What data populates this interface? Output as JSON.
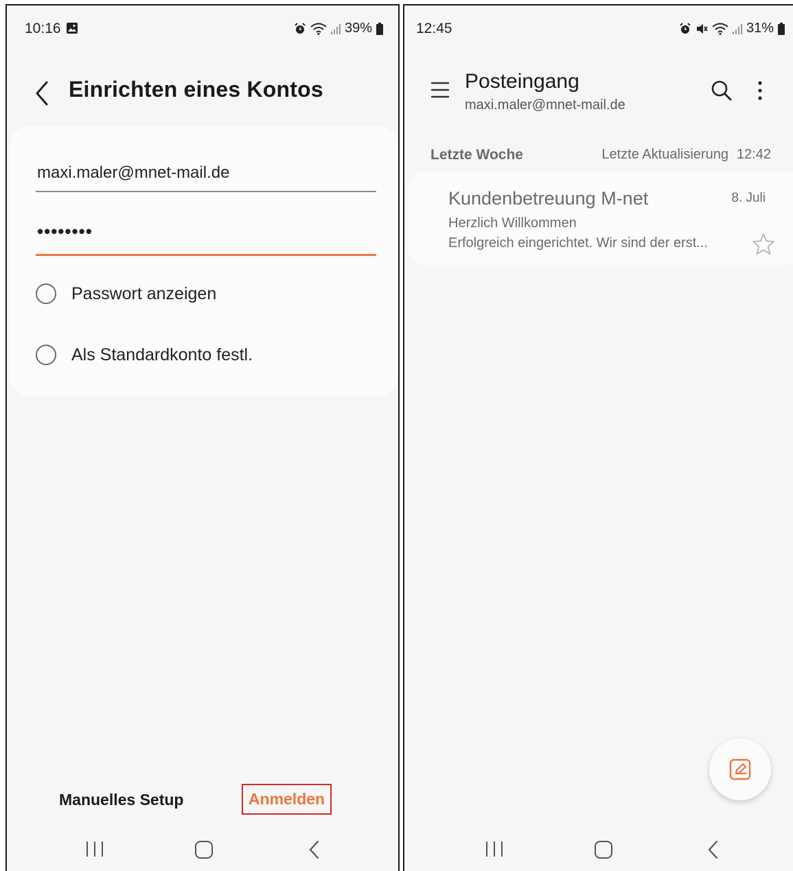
{
  "left_screen": {
    "status": {
      "time": "10:16",
      "battery": "39%"
    },
    "header": {
      "title": "Einrichten eines Kontos"
    },
    "form": {
      "email_value": "maxi.maler@mnet-mail.de",
      "password_value": "••••••••",
      "show_password_label": "Passwort anzeigen",
      "default_account_label": "Als Standardkonto festl."
    },
    "footer": {
      "manual_setup_label": "Manuelles Setup",
      "login_label": "Anmelden"
    },
    "colors": {
      "accent": "#ee7640",
      "highlight_box": "#d42a2a"
    }
  },
  "right_screen": {
    "status": {
      "time": "12:45",
      "battery": "31%"
    },
    "header": {
      "title": "Posteingang",
      "account": "maxi.maler@mnet-mail.de"
    },
    "section": {
      "label": "Letzte Woche",
      "last_update_label": "Letzte Aktualisierung",
      "last_update_time": "12:42"
    },
    "mails": [
      {
        "sender": "Kundenbetreuung M-net",
        "date": "8. Juli",
        "subject": "Herzlich Willkommen",
        "preview": "Erfolgreich eingerichtet.   Wir sind der erst...",
        "starred": false
      }
    ],
    "colors": {
      "accent": "#ee7640"
    }
  },
  "icons": {
    "status": [
      "image-icon",
      "alarm-icon",
      "mute-icon",
      "wifi-icon",
      "signal-icon",
      "battery-icon"
    ],
    "nav": [
      "recent-apps-icon",
      "home-icon",
      "back-icon"
    ]
  }
}
